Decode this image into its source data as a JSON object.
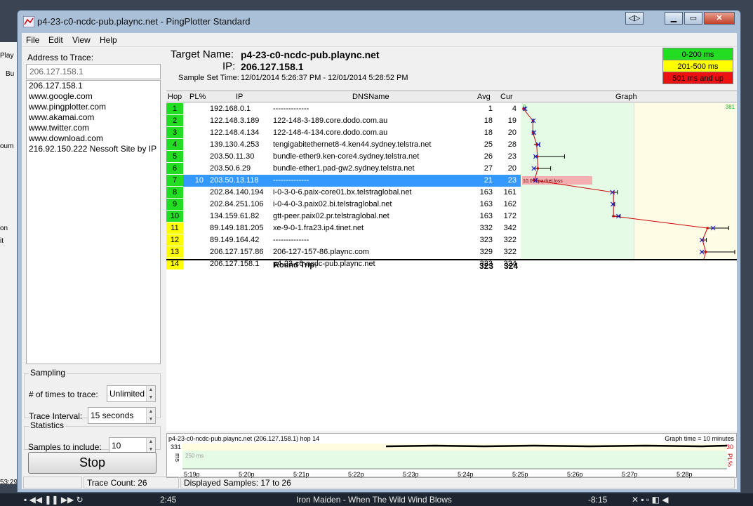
{
  "background_app": {
    "items": [
      "Play",
      "Bu",
      "oum",
      "on",
      "it",
      "53:29"
    ]
  },
  "taskbar": {
    "time": "2:45",
    "song": "Iron Maiden - When The Wild Wind Blows",
    "remaining": "-8:15"
  },
  "window": {
    "title": "p4-23-c0-ncdc-pub.plaync.net - PingPlotter Standard"
  },
  "menu": [
    "File",
    "Edit",
    "View",
    "Help"
  ],
  "left_panel": {
    "address_label": "Address to Trace:",
    "address_value": "206.127.158.1",
    "address_history": [
      "206.127.158.1",
      "www.google.com",
      "www.pingplotter.com",
      "www.akamai.com",
      "www.twitter.com",
      "www.download.com",
      "216.92.150.222 Nessoft Site by IP"
    ],
    "sampling": {
      "title": "Sampling",
      "times_label": "# of times to trace:",
      "times_value": "Unlimited",
      "interval_label": "Trace Interval:",
      "interval_value": "15 seconds"
    },
    "statistics": {
      "title": "Statistics",
      "samples_label": "Samples to include:",
      "samples_value": "10"
    },
    "stop_label": "Stop"
  },
  "target": {
    "name_label": "Target Name:",
    "name_value": "p4-23-c0-ncdc-pub.plaync.net",
    "ip_label": "IP:",
    "ip_value": "206.127.158.1",
    "sample_label": "Sample Set Time:",
    "sample_value": "12/01/2014 5:26:37 PM - 12/01/2014 5:28:52 PM"
  },
  "legend": [
    {
      "label": "0-200 ms",
      "color": "#22dd22"
    },
    {
      "label": "201-500 ms",
      "color": "#ffff00"
    },
    {
      "label": "501 ms and up",
      "color": "#ee1111"
    }
  ],
  "table": {
    "headers": {
      "hop": "Hop",
      "pl": "PL%",
      "ip": "IP",
      "dns": "DNSName",
      "avg": "Avg",
      "cur": "Cur",
      "graph": "Graph"
    },
    "rows": [
      {
        "hop": "1",
        "pl": "",
        "ip": "192.168.0.1",
        "dns": "--------------",
        "avg": "1",
        "cur": "4",
        "color": "#22dd22",
        "selected": false
      },
      {
        "hop": "2",
        "pl": "",
        "ip": "122.148.3.189",
        "dns": "122-148-3-189.core.dodo.com.au",
        "avg": "18",
        "cur": "19",
        "color": "#22dd22",
        "selected": false
      },
      {
        "hop": "3",
        "pl": "",
        "ip": "122.148.4.134",
        "dns": "122-148-4-134.core.dodo.com.au",
        "avg": "18",
        "cur": "20",
        "color": "#22dd22",
        "selected": false
      },
      {
        "hop": "4",
        "pl": "",
        "ip": "139.130.4.253",
        "dns": "tengigabitethernet8-4.ken44.sydney.telstra.net",
        "avg": "25",
        "cur": "28",
        "color": "#22dd22",
        "selected": false
      },
      {
        "hop": "5",
        "pl": "",
        "ip": "203.50.11.30",
        "dns": "bundle-ether9.ken-core4.sydney.telstra.net",
        "avg": "26",
        "cur": "23",
        "color": "#22dd22",
        "selected": false
      },
      {
        "hop": "6",
        "pl": "",
        "ip": "203.50.6.29",
        "dns": "bundle-ether1.pad-gw2.sydney.telstra.net",
        "avg": "27",
        "cur": "20",
        "color": "#22dd22",
        "selected": false
      },
      {
        "hop": "7",
        "pl": "10",
        "ip": "203.50.13.118",
        "dns": "--------------",
        "avg": "21",
        "cur": "23",
        "color": "#22dd22",
        "selected": true
      },
      {
        "hop": "8",
        "pl": "",
        "ip": "202.84.140.194",
        "dns": "i-0-3-0-6.paix-core01.bx.telstraglobal.net",
        "avg": "163",
        "cur": "161",
        "color": "#22dd22",
        "selected": false
      },
      {
        "hop": "9",
        "pl": "",
        "ip": "202.84.251.106",
        "dns": "i-0-4-0-3.paix02.bi.telstraglobal.net",
        "avg": "163",
        "cur": "162",
        "color": "#22dd22",
        "selected": false
      },
      {
        "hop": "10",
        "pl": "",
        "ip": "134.159.61.82",
        "dns": "gtt-peer.paix02.pr.telstraglobal.net",
        "avg": "163",
        "cur": "172",
        "color": "#22dd22",
        "selected": false
      },
      {
        "hop": "11",
        "pl": "",
        "ip": "89.149.181.205",
        "dns": "xe-9-0-1.fra23.ip4.tinet.net",
        "avg": "332",
        "cur": "342",
        "color": "#ffff00",
        "selected": false
      },
      {
        "hop": "12",
        "pl": "",
        "ip": "89.149.164.42",
        "dns": "--------------",
        "avg": "323",
        "cur": "322",
        "color": "#ffff00",
        "selected": false
      },
      {
        "hop": "13",
        "pl": "",
        "ip": "206.127.157.86",
        "dns": "206-127-157-86.plaync.com",
        "avg": "329",
        "cur": "322",
        "color": "#ffff00",
        "selected": false
      },
      {
        "hop": "14",
        "pl": "",
        "ip": "206.127.158.1",
        "dns": "p4-23-c0-ncdc-pub.plaync.net",
        "avg": "323",
        "cur": "324",
        "color": "#ffff00",
        "selected": false
      }
    ],
    "round_trip_label": "Round Trip:",
    "round_trip_avg": "323",
    "round_trip_cur": "324"
  },
  "graph": {
    "x_min_label": "0",
    "x_max_label": "381",
    "x_max": 381,
    "loss_label": "10.0% packet loss",
    "points": [
      {
        "hop": 1,
        "avg": 1,
        "cur": 4,
        "min": 1,
        "max": 4
      },
      {
        "hop": 2,
        "avg": 18,
        "cur": 19,
        "min": 17,
        "max": 19
      },
      {
        "hop": 3,
        "avg": 18,
        "cur": 20,
        "min": 17,
        "max": 20
      },
      {
        "hop": 4,
        "avg": 25,
        "cur": 28,
        "min": 20,
        "max": 30
      },
      {
        "hop": 5,
        "avg": 26,
        "cur": 23,
        "min": 20,
        "max": 75
      },
      {
        "hop": 6,
        "avg": 27,
        "cur": 20,
        "min": 18,
        "max": 50
      },
      {
        "hop": 7,
        "avg": 21,
        "cur": 23,
        "min": 18,
        "max": 25
      },
      {
        "hop": 8,
        "avg": 163,
        "cur": 161,
        "min": 160,
        "max": 170
      },
      {
        "hop": 9,
        "avg": 163,
        "cur": 162,
        "min": 160,
        "max": 165
      },
      {
        "hop": 10,
        "avg": 163,
        "cur": 172,
        "min": 160,
        "max": 175
      },
      {
        "hop": 11,
        "avg": 332,
        "cur": 342,
        "min": 330,
        "max": 370
      },
      {
        "hop": 12,
        "avg": 323,
        "cur": 322,
        "min": 320,
        "max": 330
      },
      {
        "hop": 13,
        "avg": 329,
        "cur": 322,
        "min": 320,
        "max": 381
      },
      {
        "hop": 14,
        "avg": 323,
        "cur": 324,
        "min": 320,
        "max": 326
      }
    ]
  },
  "timeline": {
    "title": "p4-23-c0-ncdc-pub.plaync.net (206.127.158.1) hop 14",
    "graph_time": "Graph time = 10 minutes",
    "y_max": "331",
    "y_unit": "ms",
    "band_label": "250 ms",
    "pl_max": "30",
    "pl_label": "PL%",
    "x_labels": [
      "5:19p",
      "5:20p",
      "5:21p",
      "5:22p",
      "5:23p",
      "5:24p",
      "5:25p",
      "5:26p",
      "5:27p",
      "5:28p"
    ]
  },
  "status": {
    "trace_count": "Trace Count: 26",
    "displayed": "Displayed Samples: 17 to 26"
  }
}
